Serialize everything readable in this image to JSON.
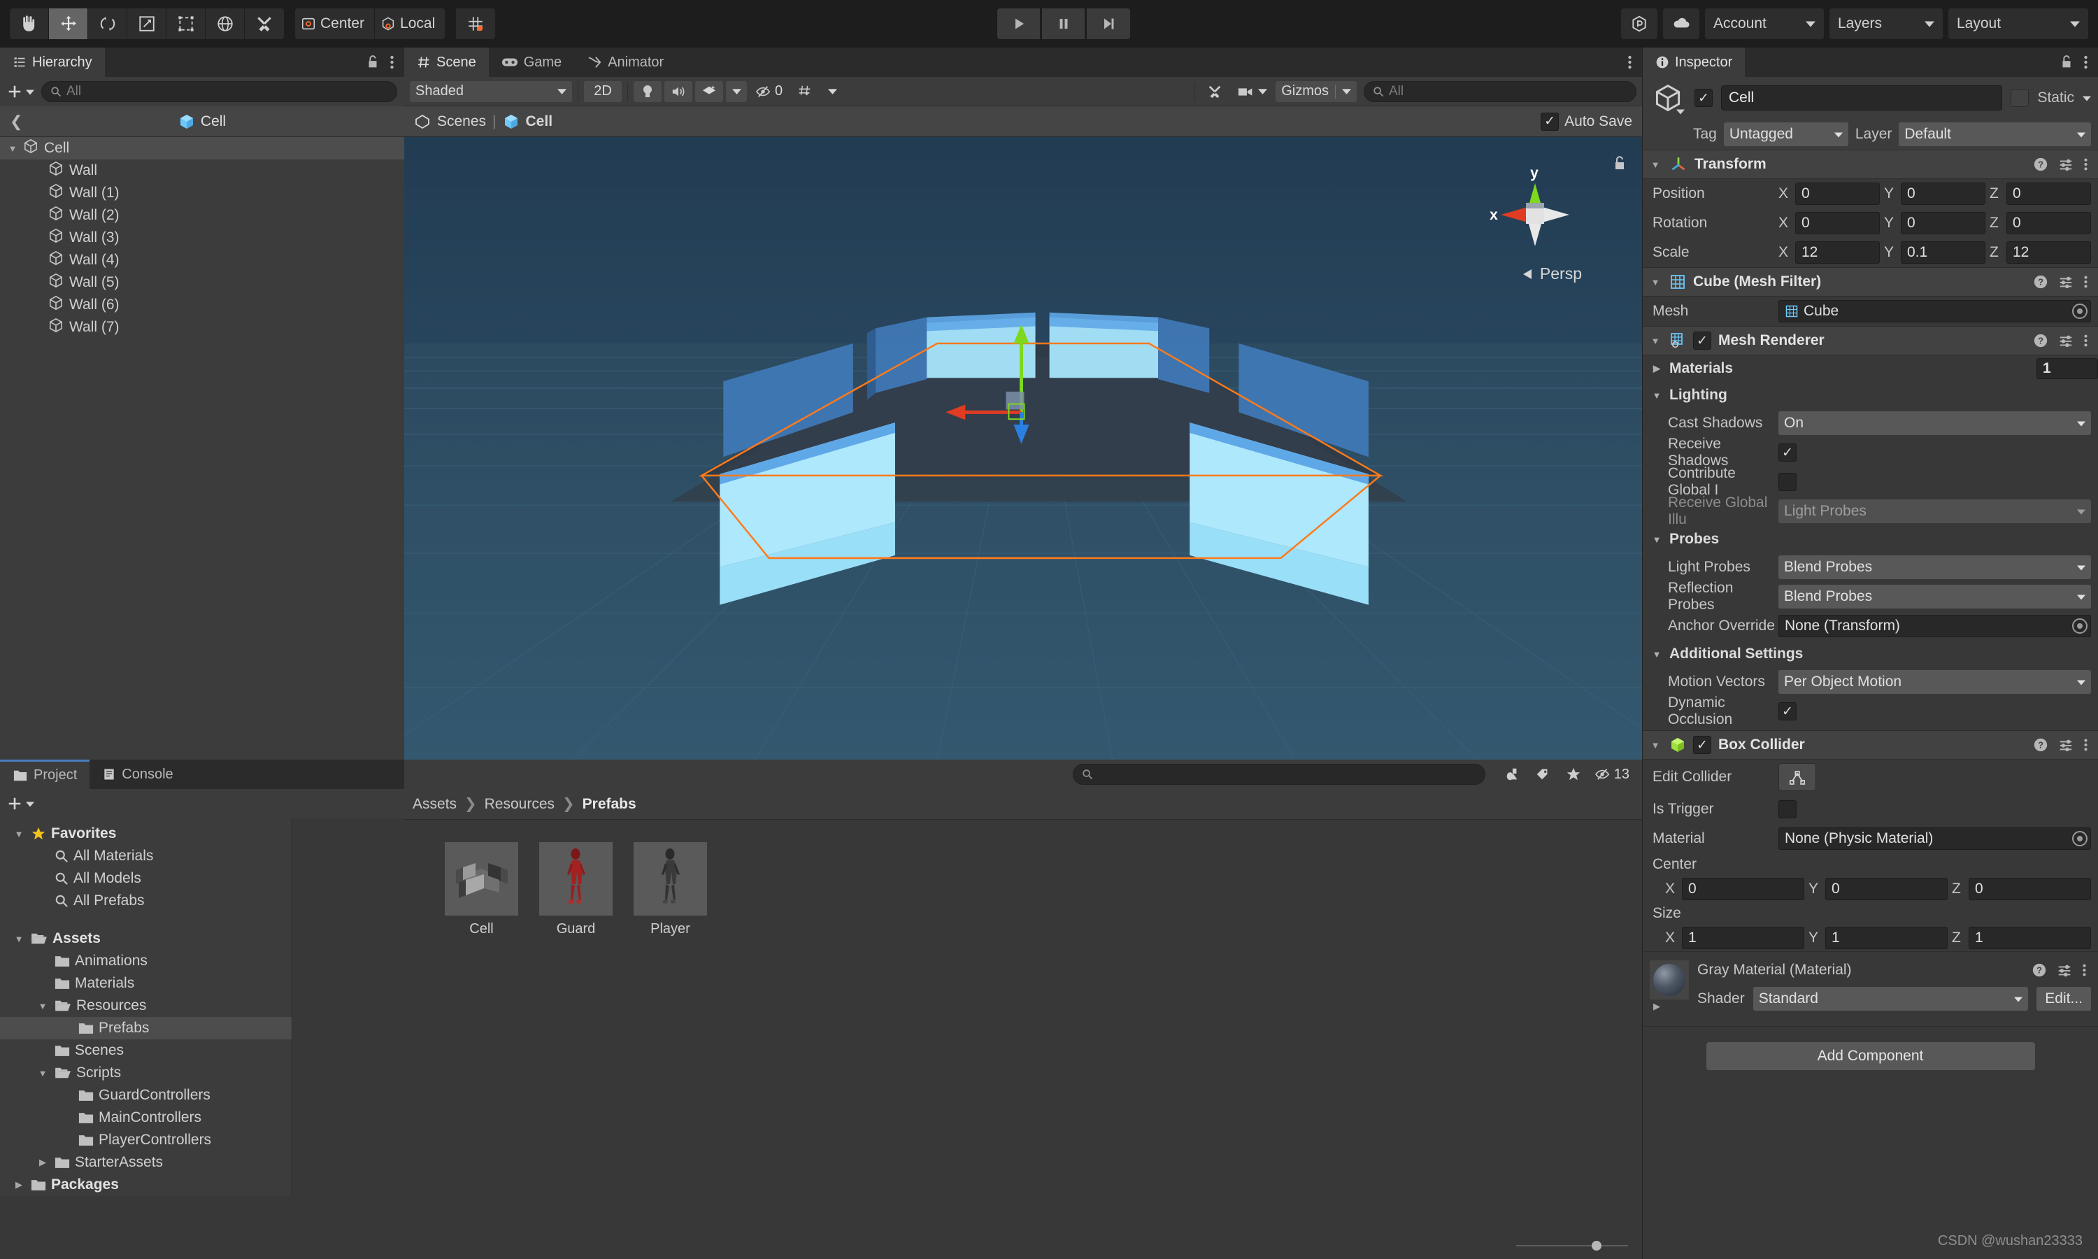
{
  "toolbar": {
    "tools": [
      {
        "name": "hand-tool",
        "icon": "hand",
        "active": false
      },
      {
        "name": "move-tool",
        "icon": "move",
        "active": true
      },
      {
        "name": "rotate-tool",
        "icon": "rotate",
        "active": false
      },
      {
        "name": "scale-tool",
        "icon": "scale",
        "active": false
      },
      {
        "name": "rect-tool",
        "icon": "rect",
        "active": false
      },
      {
        "name": "transform-tool",
        "icon": "transform",
        "active": false
      },
      {
        "name": "custom-tool",
        "icon": "wrench",
        "active": false
      }
    ],
    "pivot_mode": "Center",
    "pivot_rotation": "Local",
    "grid_snap_label": "",
    "play": "play-icon",
    "pause": "pause-icon",
    "step": "step-icon",
    "collab_icon": "collab-icon",
    "cloud_icon": "cloud-icon",
    "account": "Account",
    "layers": "Layers",
    "layout": "Layout"
  },
  "hierarchy": {
    "tab": "Hierarchy",
    "search_placeholder": "All",
    "add_label": "+",
    "breadcrumb": "Cell",
    "items": [
      {
        "label": "Cell",
        "depth": 0,
        "expanded": true,
        "selected": true
      },
      {
        "label": "Wall",
        "depth": 1,
        "expanded": false,
        "selected": false
      },
      {
        "label": "Wall (1)",
        "depth": 1,
        "expanded": false,
        "selected": false
      },
      {
        "label": "Wall (2)",
        "depth": 1,
        "expanded": false,
        "selected": false
      },
      {
        "label": "Wall (3)",
        "depth": 1,
        "expanded": false,
        "selected": false
      },
      {
        "label": "Wall (4)",
        "depth": 1,
        "expanded": false,
        "selected": false
      },
      {
        "label": "Wall (5)",
        "depth": 1,
        "expanded": false,
        "selected": false
      },
      {
        "label": "Wall (6)",
        "depth": 1,
        "expanded": false,
        "selected": false
      },
      {
        "label": "Wall (7)",
        "depth": 1,
        "expanded": false,
        "selected": false
      }
    ]
  },
  "scene": {
    "tabs": [
      {
        "label": "Scene",
        "icon": "grid-icon",
        "active": true
      },
      {
        "label": "Game",
        "icon": "gamepad-icon",
        "active": false
      },
      {
        "label": "Animator",
        "icon": "animator-icon",
        "active": false
      }
    ],
    "draw_mode": "Shaded",
    "mode_2d": "2D",
    "lighting_icon": "light-bulb-icon",
    "audio_icon": "speaker-icon",
    "fx_icon": "effects-icon",
    "hidden_count": "0",
    "grid_icon": "grid-visibility-icon",
    "tools_icon": "scene-tools-icon",
    "camera_icon": "scene-camera-icon",
    "gizmos": "Gizmos",
    "gizmo_search_placeholder": "All",
    "breadcrumb_scene": "Scenes",
    "breadcrumb_object": "Cell",
    "auto_save": "Auto Save",
    "auto_save_checked": true,
    "gizmo_axis_y": "y",
    "gizmo_axis_x": "x",
    "perspective": "Persp"
  },
  "inspector": {
    "tab": "Inspector",
    "object_name": "Cell",
    "object_enabled": true,
    "static_label": "Static",
    "static_checked": false,
    "tag_label": "Tag",
    "tag_value": "Untagged",
    "layer_label": "Layer",
    "layer_value": "Default",
    "transform": {
      "title": "Transform",
      "rows": [
        {
          "label": "Position",
          "x": "0",
          "y": "0",
          "z": "0"
        },
        {
          "label": "Rotation",
          "x": "0",
          "y": "0",
          "z": "0"
        },
        {
          "label": "Scale",
          "x": "12",
          "y": "0.1",
          "z": "12"
        }
      ]
    },
    "mesh_filter": {
      "title": "Cube (Mesh Filter)",
      "mesh_label": "Mesh",
      "mesh_value": "Cube"
    },
    "mesh_renderer": {
      "title": "Mesh Renderer",
      "enabled": true,
      "materials_label": "Materials",
      "materials_count": "1",
      "lighting_label": "Lighting",
      "cast_shadows_label": "Cast Shadows",
      "cast_shadows_value": "On",
      "receive_shadows_label": "Receive Shadows",
      "receive_shadows_checked": true,
      "contribute_gi_label": "Contribute Global I",
      "contribute_gi_checked": false,
      "receive_gi_label": "Receive Global Illu",
      "receive_gi_value": "Light Probes",
      "probes_label": "Probes",
      "light_probes_label": "Light Probes",
      "light_probes_value": "Blend Probes",
      "reflection_probes_label": "Reflection Probes",
      "reflection_probes_value": "Blend Probes",
      "anchor_override_label": "Anchor Override",
      "anchor_override_value": "None (Transform)",
      "additional_settings_label": "Additional Settings",
      "motion_vectors_label": "Motion Vectors",
      "motion_vectors_value": "Per Object Motion",
      "dynamic_occlusion_label": "Dynamic Occlusion",
      "dynamic_occlusion_checked": true
    },
    "box_collider": {
      "title": "Box Collider",
      "enabled": true,
      "edit_collider_label": "Edit Collider",
      "is_trigger_label": "Is Trigger",
      "is_trigger_checked": false,
      "material_label": "Material",
      "material_value": "None (Physic Material)",
      "center_label": "Center",
      "center": {
        "x": "0",
        "y": "0",
        "z": "0"
      },
      "size_label": "Size",
      "size": {
        "x": "1",
        "y": "1",
        "z": "1"
      }
    },
    "material": {
      "title": "Gray Material (Material)",
      "shader_label": "Shader",
      "shader_value": "Standard",
      "edit_label": "Edit..."
    },
    "add_component": "Add Component"
  },
  "project": {
    "tabs": [
      {
        "label": "Project",
        "icon": "folder-icon",
        "active": true
      },
      {
        "label": "Console",
        "icon": "console-icon",
        "active": false
      }
    ],
    "search_placeholder": "",
    "filter_icons": [
      "asset-type-filter-icon",
      "label-filter-icon",
      "favorite-filter-icon"
    ],
    "hidden_count": "13",
    "tree": [
      {
        "label": "Favorites",
        "depth": 0,
        "expanded": true,
        "icon": "star",
        "bold": true,
        "selected": false
      },
      {
        "label": "All Materials",
        "depth": 1,
        "icon": "search",
        "bold": false,
        "selected": false
      },
      {
        "label": "All Models",
        "depth": 1,
        "icon": "search",
        "bold": false,
        "selected": false
      },
      {
        "label": "All Prefabs",
        "depth": 1,
        "icon": "search",
        "bold": false,
        "selected": false
      },
      {
        "label": "",
        "depth": 0,
        "icon": "spacer",
        "bold": false,
        "selected": false
      },
      {
        "label": "Assets",
        "depth": 0,
        "expanded": true,
        "icon": "folder-open",
        "bold": true,
        "selected": false
      },
      {
        "label": "Animations",
        "depth": 1,
        "icon": "folder",
        "bold": false,
        "selected": false
      },
      {
        "label": "Materials",
        "depth": 1,
        "icon": "folder",
        "bold": false,
        "selected": false
      },
      {
        "label": "Resources",
        "depth": 1,
        "expanded": true,
        "icon": "folder-open",
        "bold": false,
        "selected": false
      },
      {
        "label": "Prefabs",
        "depth": 2,
        "icon": "folder",
        "bold": false,
        "selected": true
      },
      {
        "label": "Scenes",
        "depth": 1,
        "icon": "folder",
        "bold": false,
        "selected": false
      },
      {
        "label": "Scripts",
        "depth": 1,
        "expanded": true,
        "icon": "folder-open",
        "bold": false,
        "selected": false
      },
      {
        "label": "GuardControllers",
        "depth": 2,
        "icon": "folder",
        "bold": false,
        "selected": false
      },
      {
        "label": "MainControllers",
        "depth": 2,
        "icon": "folder",
        "bold": false,
        "selected": false
      },
      {
        "label": "PlayerControllers",
        "depth": 2,
        "icon": "folder",
        "bold": false,
        "selected": false
      },
      {
        "label": "StarterAssets",
        "depth": 1,
        "expanded": false,
        "icon": "folder",
        "bold": false,
        "selected": false
      },
      {
        "label": "Packages",
        "depth": 0,
        "expanded": false,
        "icon": "folder",
        "bold": true,
        "selected": false
      }
    ],
    "breadcrumb": [
      "Assets",
      "Resources",
      "Prefabs"
    ],
    "assets": [
      {
        "label": "Cell",
        "thumb": "cell-prefab-thumbnail"
      },
      {
        "label": "Guard",
        "thumb": "guard-prefab-thumbnail"
      },
      {
        "label": "Player",
        "thumb": "player-prefab-thumbnail"
      }
    ]
  },
  "watermark": "CSDN @wushan23333"
}
